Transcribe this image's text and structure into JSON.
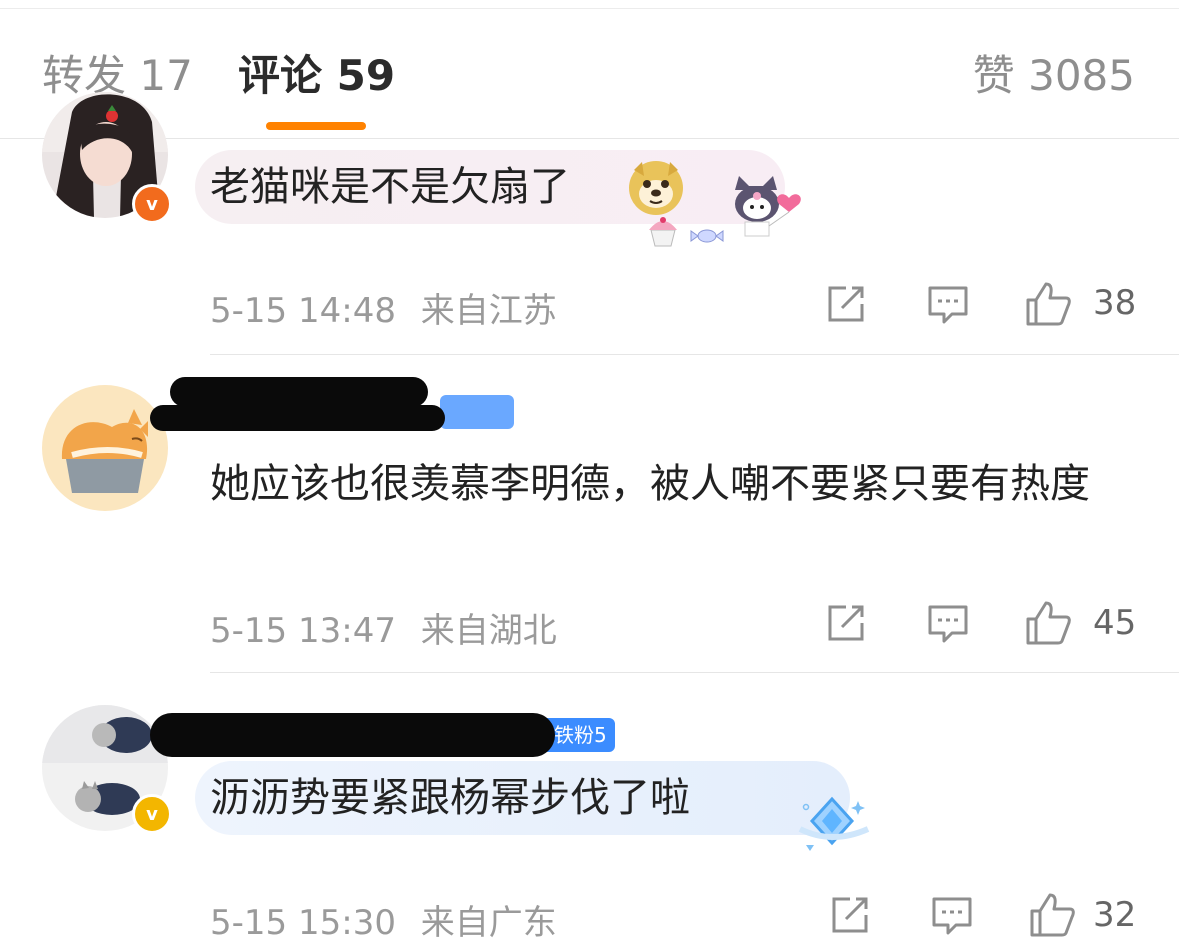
{
  "tabs": {
    "repost": {
      "label": "转发 17"
    },
    "comments": {
      "label": "评论 59"
    },
    "likes": {
      "label": "赞 3085"
    }
  },
  "accent_color": "#ff8200",
  "comments": [
    {
      "text": "老猫咪是不是欠扇了",
      "time": "5-15 14:48",
      "location": "来自江苏",
      "likes": "38",
      "badge": "v",
      "badge_color": "#f26b1d",
      "emoji": "doge-face"
    },
    {
      "text": "她应该也很羡慕李明德，被人嘲不要紧只要有热度",
      "time": "5-15 13:47",
      "location": "来自湖北",
      "likes": "45"
    },
    {
      "level_badge": "铁粉5",
      "text": "沥沥势要紧跟杨幂步伐了啦",
      "time": "5-15 15:30",
      "location": "来自广东",
      "likes": "32",
      "badge": "v",
      "badge_color": "#f3b600"
    }
  ],
  "icons": {
    "share": "share-icon",
    "reply": "reply-icon",
    "like": "like-icon"
  }
}
